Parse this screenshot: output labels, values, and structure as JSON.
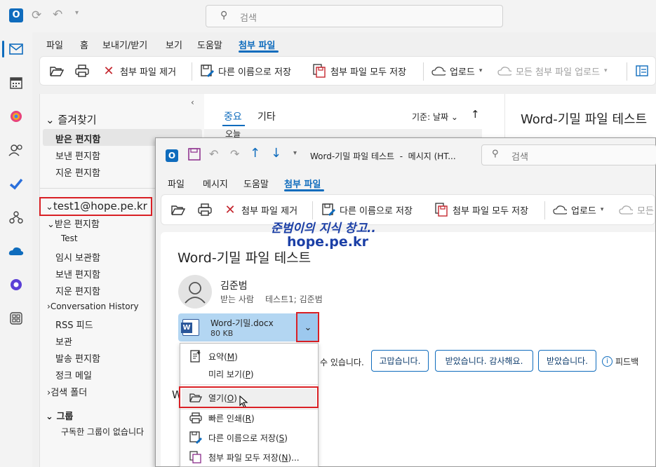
{
  "main": {
    "search_placeholder": "검색",
    "menu_tabs": [
      "파일",
      "홈",
      "보내기/받기",
      "보기",
      "도움말",
      "첨부 파일"
    ],
    "ribbon": {
      "remove_attachment": "첨부 파일 제거",
      "save_as": "다른 이름으로 저장",
      "save_all": "첨부 파일 모두 저장",
      "upload": "업로드",
      "upload_all": "모든 첨부 파일 업로드"
    },
    "favorites": {
      "header": "즐겨찾기",
      "items": [
        "받은 편지함",
        "보낸 편지함",
        "지운 편지함"
      ]
    },
    "account": {
      "name": "test1@hope.pe.kr",
      "folders": [
        "받은 편지함",
        "Test",
        "임시 보관함",
        "보낸 편지함",
        "지운 편지함",
        "Conversation History",
        "RSS 피드",
        "보관",
        "발송 편지함",
        "정크 메일",
        "검색 폴더"
      ]
    },
    "groups": {
      "header": "그룹",
      "empty": "구독한 그룹이 없습니다"
    },
    "list_tabs": [
      "중요",
      "기타"
    ],
    "sort_label": "기준: 날짜",
    "today": "오늘",
    "reading_title": "Word-기밀 파일 테스트"
  },
  "popup": {
    "window_title": "Word-기밀 파일 테스트  -  메시지 (HT...",
    "search_placeholder": "검색",
    "menu_tabs": [
      "파일",
      "메시지",
      "도움말",
      "첨부 파일"
    ],
    "ribbon": {
      "remove_attachment": "첨부 파일 제거",
      "save_as": "다른 이름으로 저장",
      "save_all": "첨부 파일 모두 저장",
      "upload": "업로드",
      "upload_all_short": "모든"
    },
    "watermark1": "준범이의 지식 창고..",
    "watermark2": "hope.pe.kr",
    "subject": "Word-기밀 파일 테스트",
    "sender": "김준범",
    "to_label": "받는 사람",
    "to_value": "테스트1; 김준범",
    "attachment": {
      "name": "Word-기밀.docx",
      "size": "80 KB"
    },
    "reply_hint": "수 있습니다.",
    "quick_replies": [
      "고맙습니다.",
      "받았습니다. 감사해요.",
      "받았습니다."
    ],
    "feedback": "피드백",
    "body_letter": "W"
  },
  "context_menu": {
    "items": [
      {
        "label": "요약",
        "key": "M"
      },
      {
        "label": "미리 보기",
        "key": "P"
      },
      {
        "label": "열기",
        "key": "O"
      },
      {
        "label": "빠른 인쇄",
        "key": "R"
      },
      {
        "label": "다른 이름으로 저장",
        "key": "S"
      },
      {
        "label": "첨부 파일 모두 저장",
        "key": "N",
        "suffix": "..."
      }
    ]
  },
  "colors": {
    "accent": "#0f6cbd",
    "highlight": "#d92025",
    "attachment_bg": "#b3d6f2",
    "watermark": "#1b3fa6"
  }
}
